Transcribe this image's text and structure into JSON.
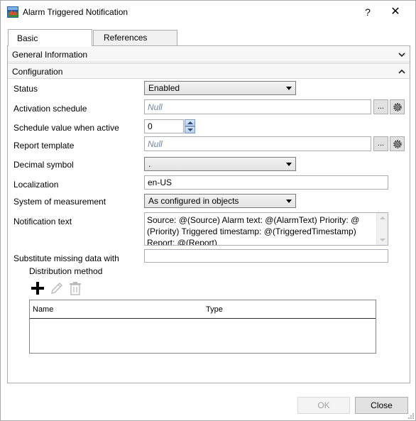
{
  "window": {
    "title": "Alarm Triggered Notification",
    "help_label": "?",
    "close_label": "✕"
  },
  "tabs": [
    {
      "label": "Basic",
      "active": true
    },
    {
      "label": "References",
      "active": false
    }
  ],
  "sections": {
    "general": {
      "label": "General Information",
      "expanded": false
    },
    "configuration": {
      "label": "Configuration",
      "expanded": true
    }
  },
  "fields": {
    "status": {
      "label": "Status",
      "value": "Enabled"
    },
    "activation_schedule": {
      "label": "Activation schedule",
      "value": "Null",
      "button_label": "..."
    },
    "schedule_value": {
      "label": "Schedule value when active",
      "value": "0"
    },
    "report_template": {
      "label": "Report template",
      "value": "Null",
      "button_label": "..."
    },
    "decimal_symbol": {
      "label": "Decimal symbol",
      "value": "."
    },
    "localization": {
      "label": "Localization",
      "value": "en-US"
    },
    "system_of_measurement": {
      "label": "System of measurement",
      "value": "As configured in objects"
    },
    "notification_text": {
      "label": "Notification text",
      "line1": "Source: @(Source) Alarm text: @(AlarmText) Priority: @",
      "line2": "(Priority) Triggered timestamp: @(TriggeredTimestamp)",
      "line3": "Report: @(Report)"
    },
    "substitute_missing": {
      "label": "Substitute missing data with",
      "value": ""
    }
  },
  "distribution": {
    "label": "Distribution method",
    "columns": [
      "Name",
      "Type"
    ],
    "rows": []
  },
  "buttons": {
    "ok": "OK",
    "close": "Close"
  },
  "colors": {
    "placeholder_text": "#6d87a8",
    "add_icon": "#000000",
    "disabled_icon": "#b8b8b8"
  }
}
